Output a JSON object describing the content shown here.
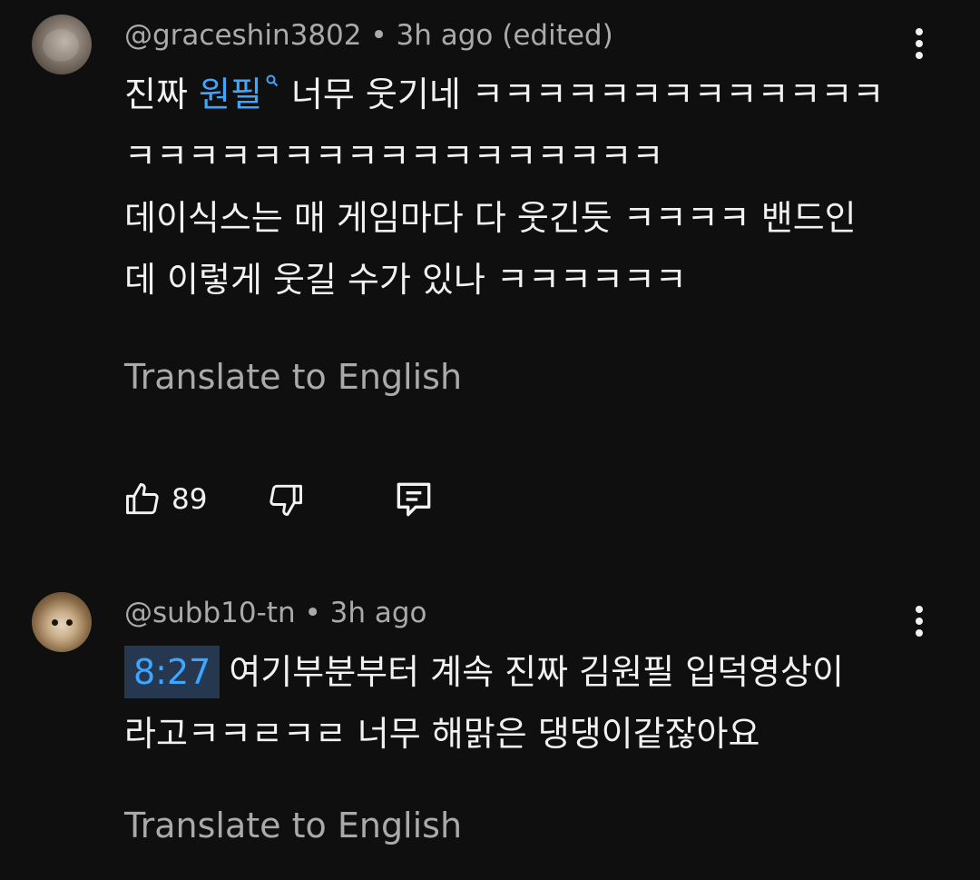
{
  "comments": [
    {
      "author": "@graceshin3802",
      "separator": "•",
      "time": "3h ago (edited)",
      "text_line1_before": "진짜 ",
      "search_link": "원필",
      "text_line1_after": "너무 웃기네 ㅋㅋㅋㅋㅋㅋㅋㅋㅋㅋㅋㅋㅋ",
      "text_line2": "ㅋㅋㅋㅋㅋㅋㅋㅋㅋㅋㅋㅋㅋㅋㅋㅋㅋ",
      "text_line3": "데이식스는 매 게임마다 다 웃긴듯 ㅋㅋㅋㅋ 밴드인",
      "text_line4": "데 이렇게 웃길 수가 있나 ㅋㅋㅋㅋㅋㅋ",
      "translate_label": "Translate to English",
      "like_count": "89"
    },
    {
      "author": "@subb10-tn",
      "separator": "•",
      "time": "3h ago",
      "timestamp": "8:27",
      "text_line1_after": "여기부분부터 계속 진짜 김원필 입덕영상이",
      "text_line2": "라고ㅋㅋㄹㅋㄹ 너무 해맑은 댕댕이같잖아요",
      "translate_label": "Translate to English"
    }
  ],
  "colors": {
    "background": "#0f0f0f",
    "text": "#f1f1f1",
    "secondary_text": "#aaaaaa",
    "link": "#3ea6ff",
    "timestamp_bg": "#263850"
  },
  "icons": {
    "like": "thumbs-up-icon",
    "dislike": "thumbs-down-icon",
    "reply": "comment-reply-icon",
    "more": "more-vertical-icon",
    "search": "search-icon"
  }
}
